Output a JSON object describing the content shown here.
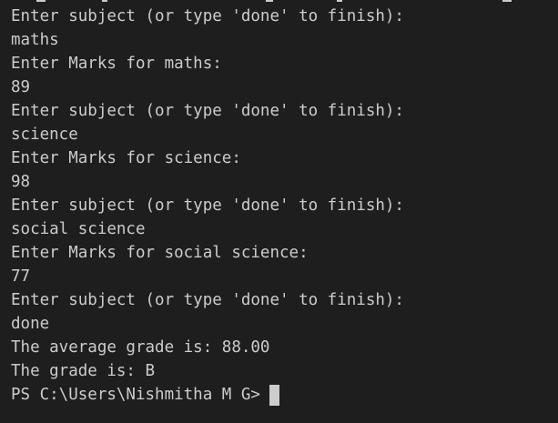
{
  "terminal": {
    "lines": [
      "Enter subject (or type 'done' to finish):",
      "maths",
      "Enter Marks for maths:",
      "89",
      "Enter subject (or type 'done' to finish):",
      "science",
      "Enter Marks for science:",
      "98",
      "Enter subject (or type 'done' to finish):",
      "social science",
      "Enter Marks for social science:",
      "77",
      "Enter subject (or type 'done' to finish):",
      "done",
      "The average grade is: 88.00",
      "The grade is: B"
    ],
    "prompt": "PS C:\\Users\\Nishmitha M G>"
  },
  "colors": {
    "background": "#1e1e1e",
    "foreground": "#cccccc"
  }
}
